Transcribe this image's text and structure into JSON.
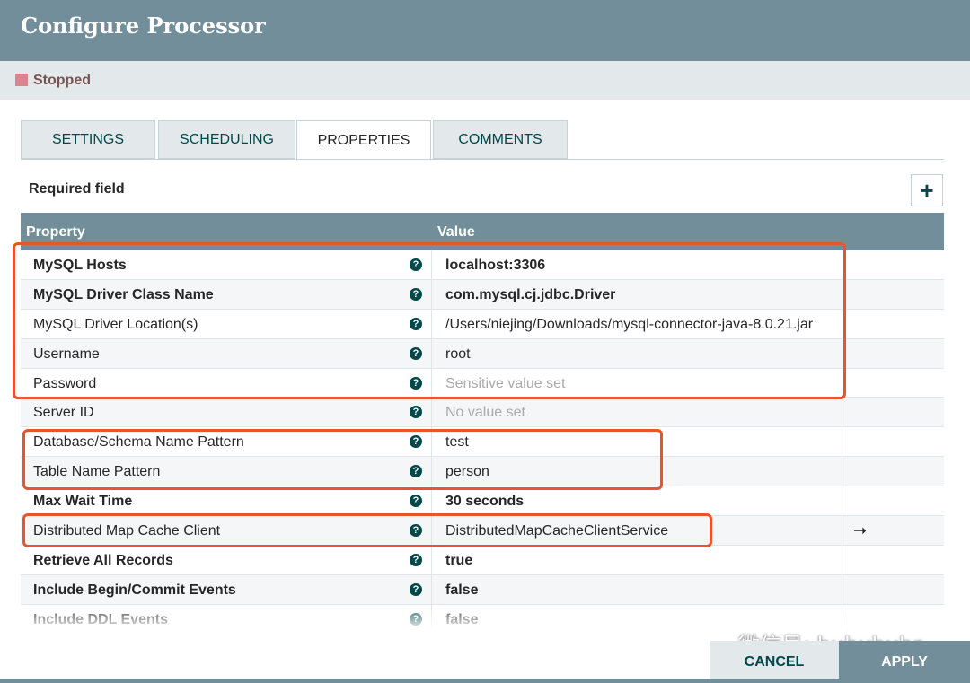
{
  "dialog": {
    "title": "Configure Processor"
  },
  "status": {
    "text": "Stopped",
    "color": "#d9848e"
  },
  "tabs": [
    {
      "label": "SETTINGS",
      "active": false
    },
    {
      "label": "SCHEDULING",
      "active": false
    },
    {
      "label": "PROPERTIES",
      "active": true
    },
    {
      "label": "COMMENTS",
      "active": false
    }
  ],
  "required_label": "Required field",
  "add_icon": "plus-icon",
  "table": {
    "headers": {
      "property": "Property",
      "value": "Value"
    },
    "rows": [
      {
        "name": "MySQL Hosts",
        "required": true,
        "value": "localhost:3306",
        "value_bold": true,
        "placeholder": false
      },
      {
        "name": "MySQL Driver Class Name",
        "required": true,
        "value": "com.mysql.cj.jdbc.Driver",
        "value_bold": true,
        "placeholder": false
      },
      {
        "name": "MySQL Driver Location(s)",
        "required": false,
        "value": "/Users/niejing/Downloads/mysql-connector-java-8.0.21.jar",
        "value_bold": false,
        "placeholder": false
      },
      {
        "name": "Username",
        "required": false,
        "value": "root",
        "value_bold": false,
        "placeholder": false
      },
      {
        "name": "Password",
        "required": false,
        "value": "Sensitive value set",
        "value_bold": false,
        "placeholder": true
      },
      {
        "name": "Server ID",
        "required": false,
        "value": "No value set",
        "value_bold": false,
        "placeholder": true
      },
      {
        "name": "Database/Schema Name Pattern",
        "required": false,
        "value": "test",
        "value_bold": false,
        "placeholder": false
      },
      {
        "name": "Table Name Pattern",
        "required": false,
        "value": "person",
        "value_bold": false,
        "placeholder": false
      },
      {
        "name": "Max Wait Time",
        "required": true,
        "value": "30 seconds",
        "value_bold": true,
        "placeholder": false
      },
      {
        "name": "Distributed Map Cache Client",
        "required": false,
        "value": "DistributedMapCacheClientService",
        "value_bold": false,
        "placeholder": false,
        "has_arrow": true
      },
      {
        "name": "Retrieve All Records",
        "required": true,
        "value": "true",
        "value_bold": true,
        "placeholder": false
      },
      {
        "name": "Include Begin/Commit Events",
        "required": true,
        "value": "false",
        "value_bold": true,
        "placeholder": false
      },
      {
        "name": "Include DDL Events",
        "required": true,
        "value": "false",
        "value_bold": true,
        "placeholder": false
      }
    ]
  },
  "buttons": {
    "cancel": "CANCEL",
    "apply": "APPLY"
  },
  "watermark": {
    "text": "微信号: huhuhuhr",
    "icon": "wechat-icon"
  },
  "colors": {
    "header": "#728e9b",
    "accent": "#004849",
    "highlight": "#e8542c"
  }
}
